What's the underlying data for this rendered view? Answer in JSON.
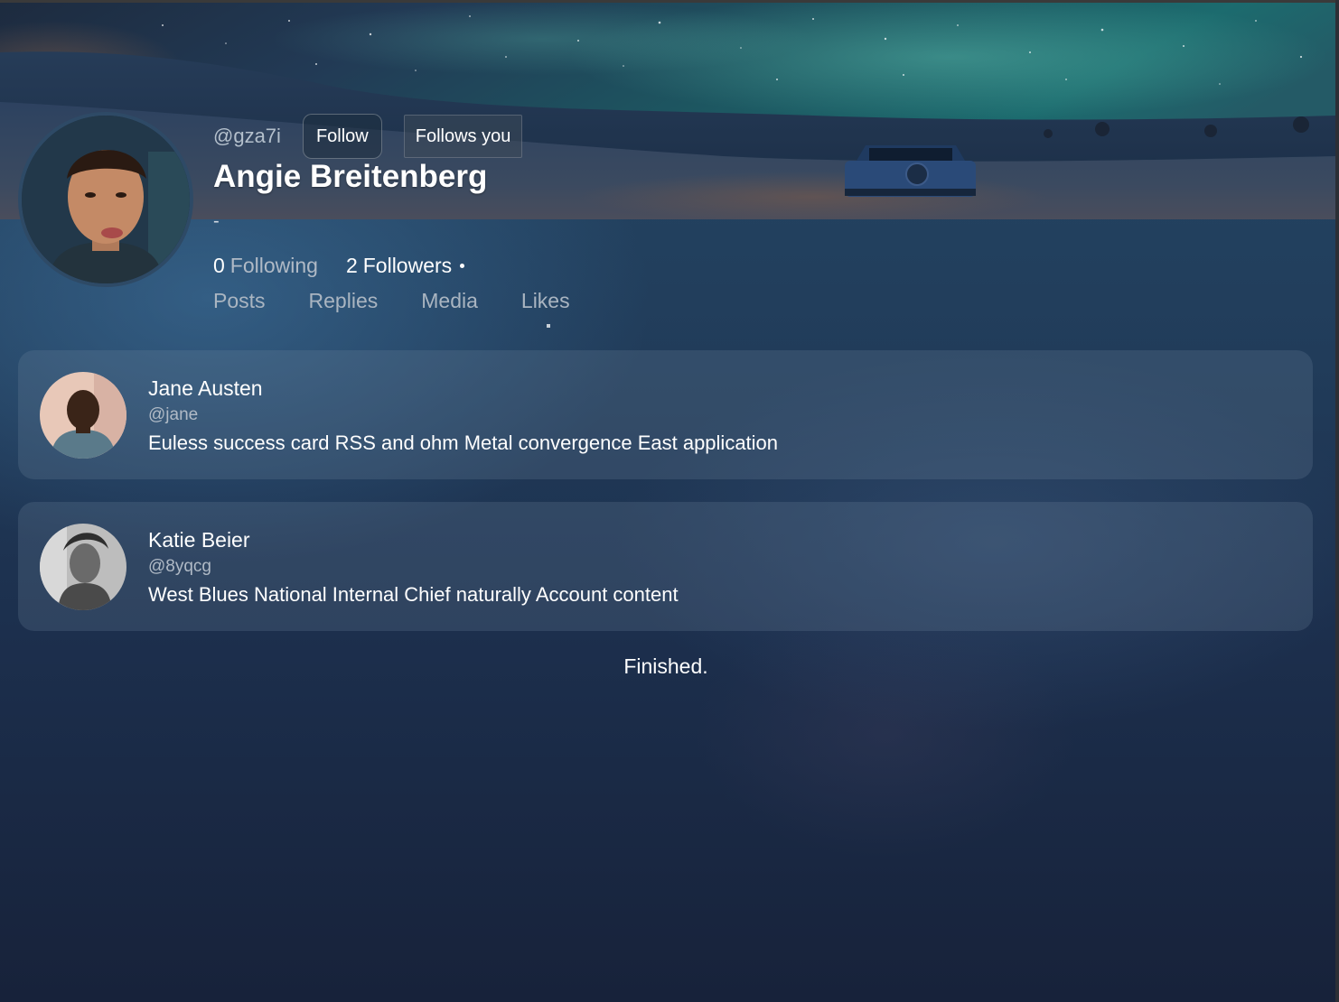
{
  "profile": {
    "handle": "@gza7i",
    "follow_label": "Follow",
    "follows_you_label": "Follows you",
    "display_name": "Angie Breitenberg",
    "bio": "-",
    "following_count": "0",
    "following_label": "Following",
    "followers_count": "2",
    "followers_label": "Followers"
  },
  "tabs": [
    {
      "label": "Posts"
    },
    {
      "label": "Replies"
    },
    {
      "label": "Media"
    },
    {
      "label": "Likes"
    }
  ],
  "active_tab": "Likes",
  "posts": [
    {
      "author": "Jane Austen",
      "handle": "@jane",
      "text": "Euless success card RSS and ohm Metal convergence East application"
    },
    {
      "author": "Katie Beier",
      "handle": "@8yqcg",
      "text": "West Blues National Internal Chief naturally Account content"
    }
  ],
  "footer": {
    "status": "Finished."
  },
  "colors": {
    "background_top": "#254866",
    "background_bottom": "#17223a",
    "card": "rgba(120,140,165,0.22)",
    "muted_text": "#b0bac6"
  }
}
